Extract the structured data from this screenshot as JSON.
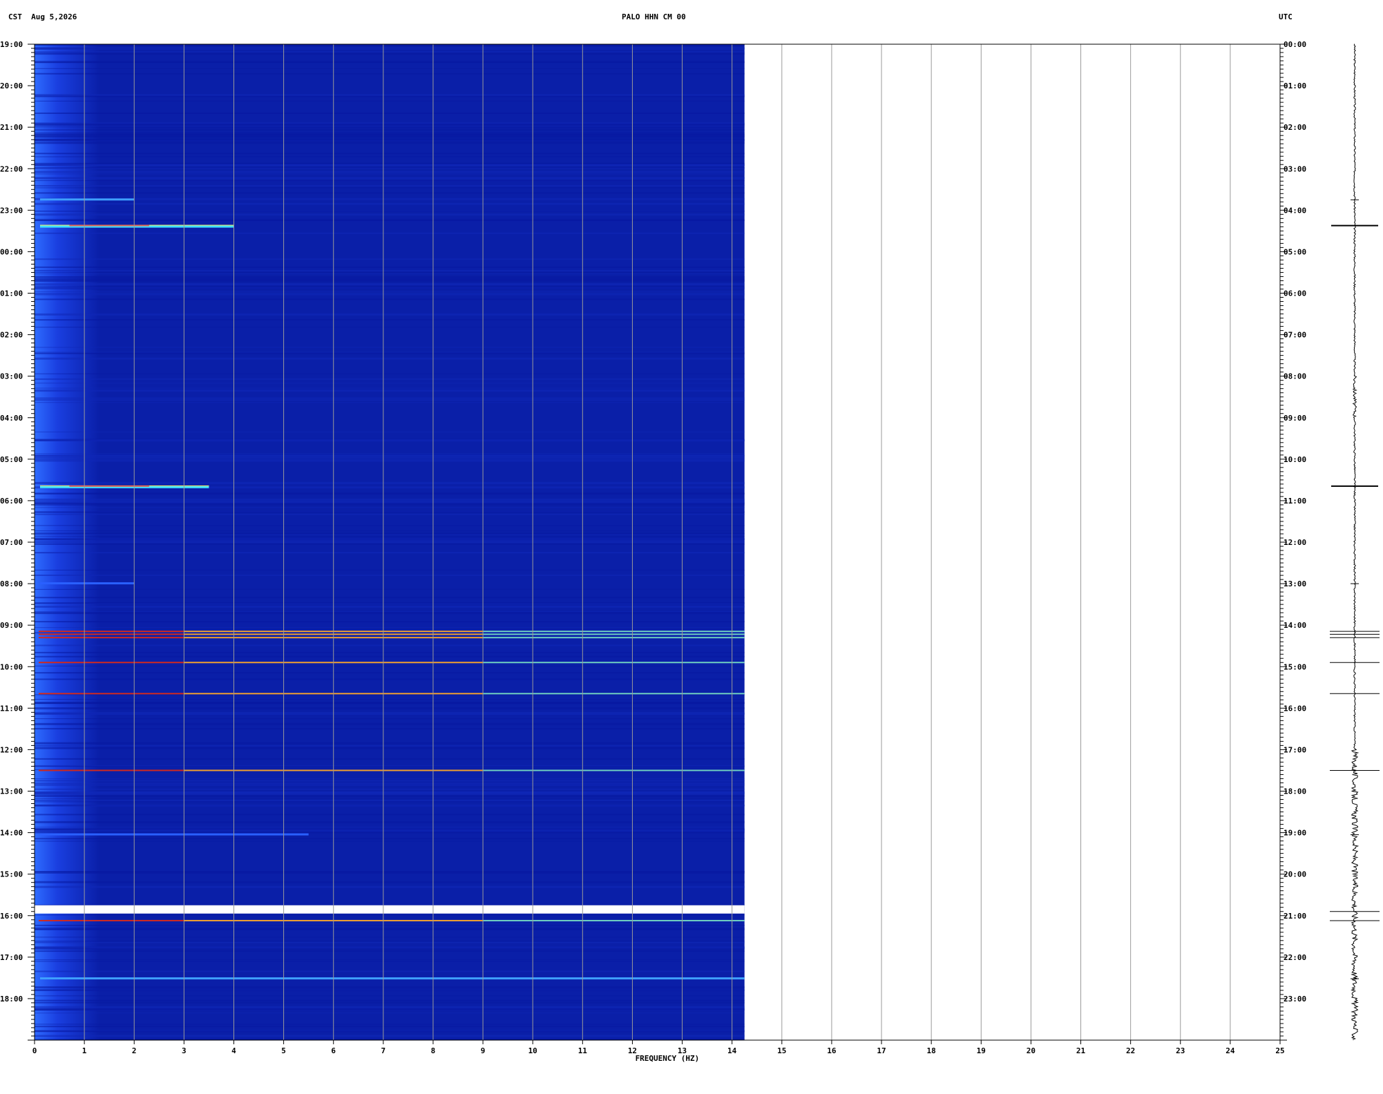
{
  "header": {
    "timezone_left": "CST",
    "date": "Aug 5,2026",
    "station": "PALO HHN CM 00",
    "timezone_right": "UTC"
  },
  "chart_data": {
    "type": "heatmap",
    "title": "PALO HHN CM 00",
    "xlabel": "FREQUENCY (HZ)",
    "ylabel_left": "CST",
    "ylabel_right": "UTC",
    "xlim": [
      0,
      25
    ],
    "x_ticks": [
      "0",
      "1",
      "2",
      "3",
      "4",
      "5",
      "6",
      "7",
      "8",
      "9",
      "10",
      "11",
      "12",
      "13",
      "14",
      "15",
      "16",
      "17",
      "18",
      "19",
      "20",
      "21",
      "22",
      "23",
      "24",
      "25"
    ],
    "data_xmax": 14.25,
    "time_span_hours": 24,
    "left_time_ticks": [
      "19:00",
      "20:00",
      "21:00",
      "22:00",
      "23:00",
      "00:00",
      "01:00",
      "02:00",
      "03:00",
      "04:00",
      "05:00",
      "06:00",
      "07:00",
      "08:00",
      "09:00",
      "10:00",
      "11:00",
      "12:00",
      "13:00",
      "14:00",
      "15:00",
      "16:00",
      "17:00",
      "18:00"
    ],
    "right_time_ticks": [
      "00:00",
      "01:00",
      "02:00",
      "03:00",
      "04:00",
      "05:00",
      "06:00",
      "07:00",
      "08:00",
      "09:00",
      "10:00",
      "11:00",
      "12:00",
      "13:00",
      "14:00",
      "15:00",
      "16:00",
      "17:00",
      "18:00",
      "19:00",
      "20:00",
      "21:00",
      "22:00",
      "23:00"
    ],
    "background_color": "#0a1fa8",
    "low_freq_band_color": "#1a3fe0",
    "data_gap": {
      "start_hours": 20.75,
      "end_hours": 20.95
    },
    "events": [
      {
        "hours": 3.75,
        "fmax": 2.0,
        "style": "light"
      },
      {
        "hours": 4.37,
        "fmax": 4.0,
        "style": "strong"
      },
      {
        "hours": 10.65,
        "fmax": 3.5,
        "style": "strong"
      },
      {
        "hours": 13.0,
        "fmax": 2.0,
        "style": "faint"
      },
      {
        "hours": 14.15,
        "fmax": 14.25,
        "style": "line"
      },
      {
        "hours": 14.22,
        "fmax": 14.25,
        "style": "line"
      },
      {
        "hours": 14.3,
        "fmax": 14.25,
        "style": "line"
      },
      {
        "hours": 14.9,
        "fmax": 14.25,
        "style": "line"
      },
      {
        "hours": 15.65,
        "fmax": 14.25,
        "style": "line"
      },
      {
        "hours": 17.5,
        "fmax": 14.25,
        "style": "line"
      },
      {
        "hours": 20.9,
        "fmax": 14.25,
        "style": "line"
      },
      {
        "hours": 21.12,
        "fmax": 14.25,
        "style": "line"
      },
      {
        "hours": 22.52,
        "fmax": 14.25,
        "style": "light"
      },
      {
        "hours": 19.05,
        "fmax": 5.5,
        "style": "faint"
      }
    ]
  }
}
